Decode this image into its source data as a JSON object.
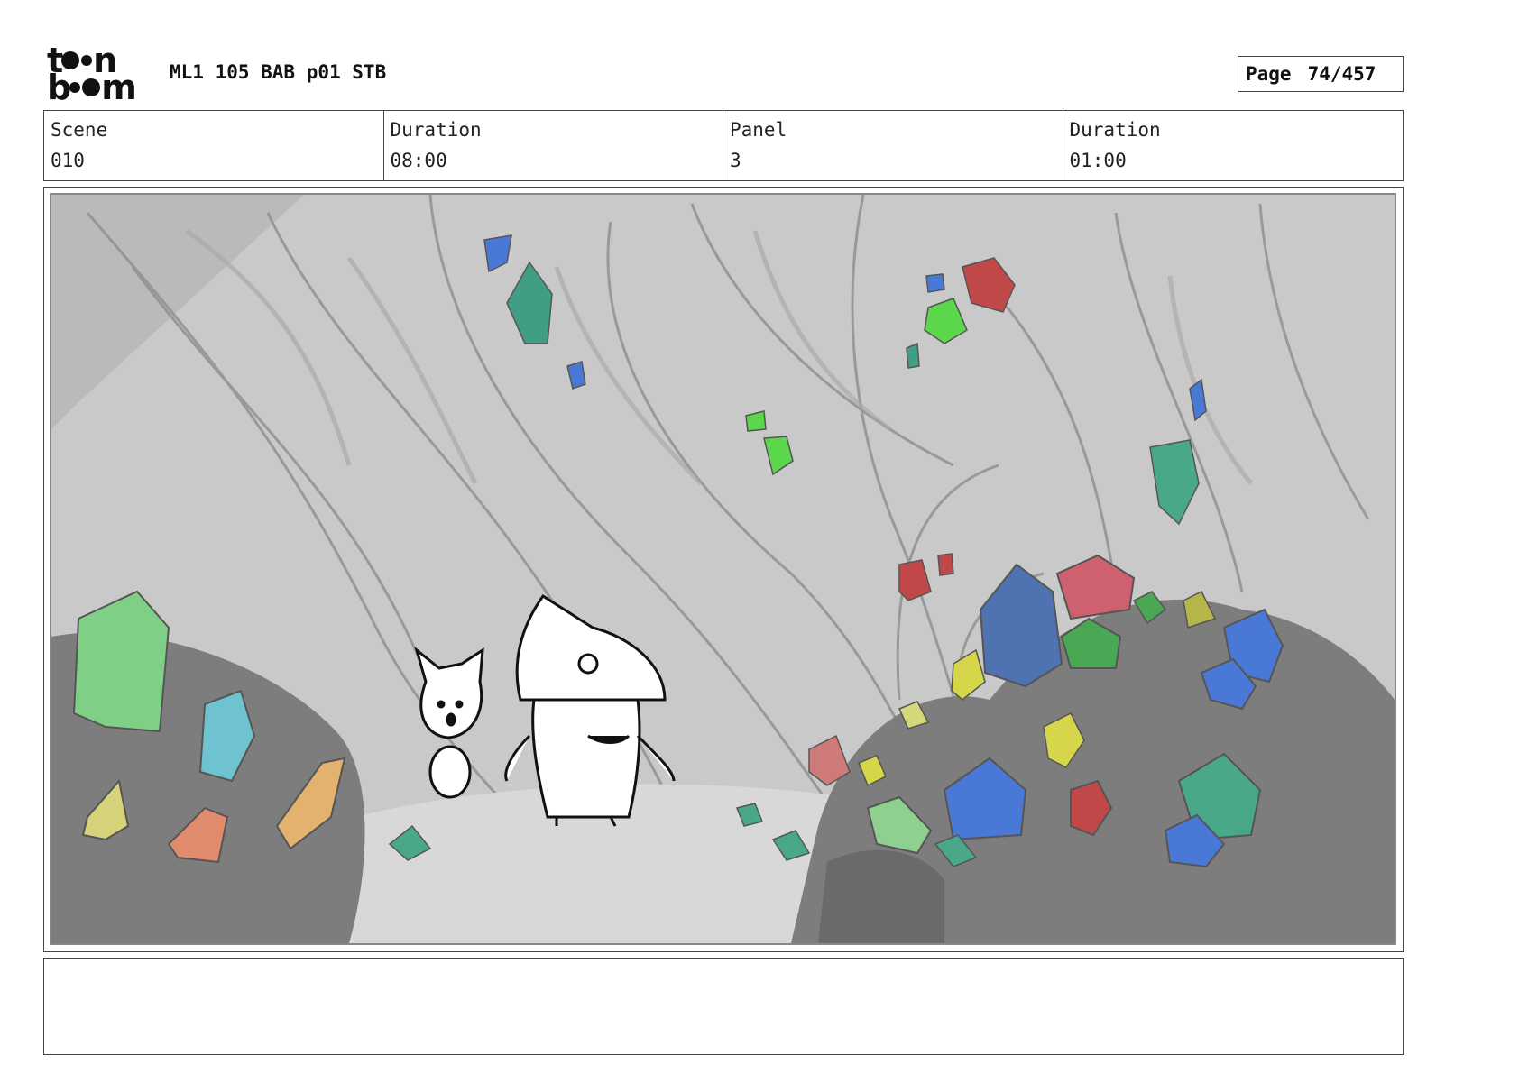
{
  "header": {
    "logo_text": "toon boom",
    "doc_title": "ML1 105 BAB p01 STB",
    "page_label": "Page",
    "page_number": "74/457"
  },
  "info": {
    "scene_label": "Scene",
    "scene_value": "010",
    "scene_duration_label": "Duration",
    "scene_duration_value": "08:00",
    "panel_label": "Panel",
    "panel_value": "3",
    "panel_duration_label": "Duration",
    "panel_duration_value": "01:00"
  },
  "panel": {
    "art_subject": "cave-with-crystals-and-two-characters"
  },
  "notes": {
    "text": ""
  },
  "colors": {
    "border": "#444444",
    "cave_bg": "#c9c9c9",
    "rock_dark": "#7d7d7d",
    "crystal_green": "#5fbf6e",
    "crystal_blue": "#4a78d6",
    "crystal_red": "#c04848",
    "crystal_teal": "#3f9e84",
    "crystal_yellow": "#d8d65a",
    "crystal_orange": "#e0a860",
    "crystal_lime": "#5cd64a"
  }
}
